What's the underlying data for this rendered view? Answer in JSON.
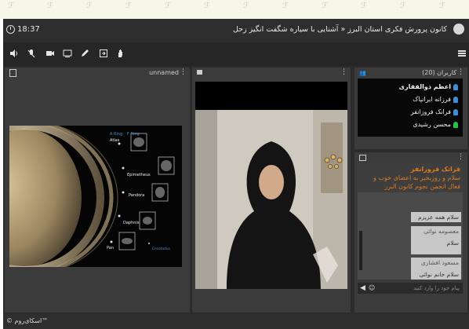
{
  "window": {
    "clock": "18:37",
    "title": "کانون پرورش فکری استان البرز « آشنایی با سیاره شگفت انگیز زحل"
  },
  "toolbar": {
    "items": [
      "speaker-icon",
      "mic-muted-icon",
      "camera-icon",
      "screen-share-icon",
      "pen-icon",
      "exit-icon",
      "raise-hand-icon"
    ]
  },
  "presentation": {
    "tab_name": "unnamed",
    "labels": {
      "ring_a": "A Ring",
      "ring_b": "F Ring",
      "moon1": "Atlas",
      "moon2": "Epimetheus",
      "moon3": "Pandora",
      "moon4": "Daphnis",
      "moon5": "Pan",
      "moon6": "Enceladus"
    }
  },
  "users": {
    "header": "کاربران (20)",
    "list": [
      "اعظم ذوالفقاری",
      "فرزانه ایرانپاک",
      "فرانک فروزانفر",
      "محسن رشیدی"
    ]
  },
  "chat": {
    "announce_sender": "فرانک فروزانفر",
    "announce_text": "سلام و روزبخیر به اعضای خوب و فعال انجمن نجوم کانون البرز",
    "messages": [
      {
        "sender": "",
        "text": "سلام همه عزیزم"
      },
      {
        "sender": "معصومه نوائی",
        "text": "سلام"
      },
      {
        "sender": "مسعود افشاری",
        "text": "سلام خانم نوائی"
      }
    ],
    "input_placeholder": "پیام خود را وارد کنید"
  },
  "footer": {
    "brand": "© اسکای‌روم™"
  },
  "colors": {
    "announce": "#e07a1e",
    "user_online": "#3a8fd6",
    "user_active": "#2bbf4a"
  }
}
